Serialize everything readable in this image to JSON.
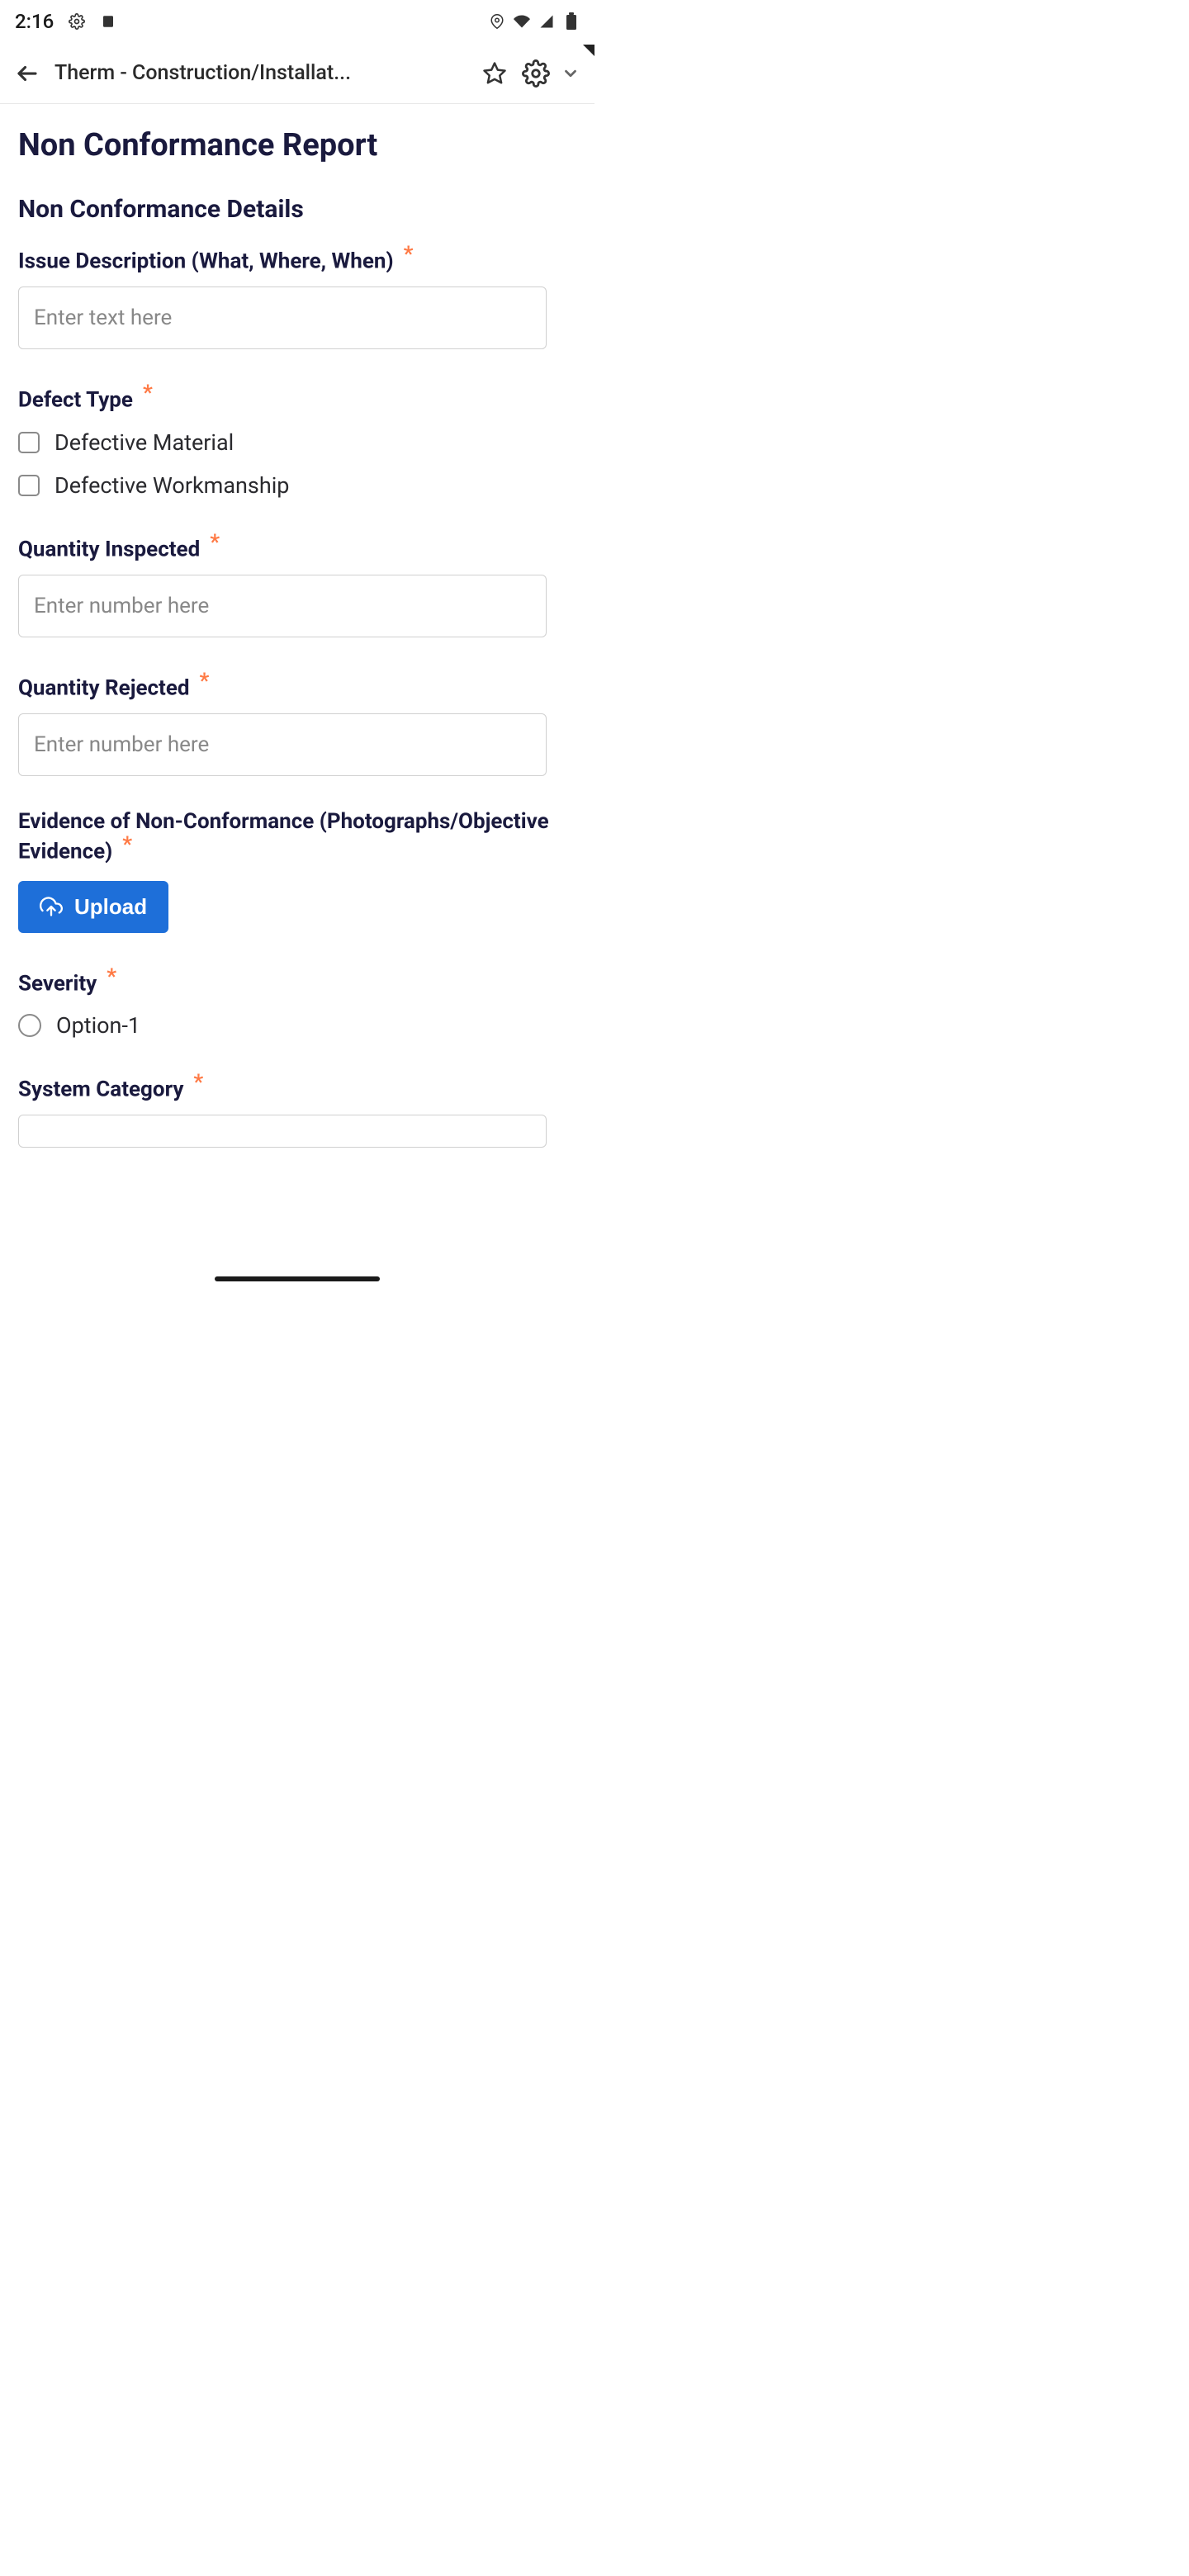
{
  "status_bar": {
    "time": "2:16",
    "icons_left": [
      "gear",
      "card"
    ],
    "icons_right": [
      "location",
      "wifi",
      "signal",
      "battery"
    ]
  },
  "top_bar": {
    "title": "Therm - Construction/Installat..."
  },
  "page": {
    "title": "Non Conformance Report",
    "section_title": "Non Conformance Details"
  },
  "fields": {
    "issue_description": {
      "label": "Issue Description (What, Where, When)",
      "required": true,
      "placeholder": "Enter text here"
    },
    "defect_type": {
      "label": "Defect Type",
      "required": true,
      "options": [
        {
          "label": "Defective Material",
          "checked": false
        },
        {
          "label": "Defective Workmanship",
          "checked": false
        }
      ]
    },
    "quantity_inspected": {
      "label": "Quantity Inspected",
      "required": true,
      "placeholder": "Enter number here"
    },
    "quantity_rejected": {
      "label": "Quantity Rejected",
      "required": true,
      "placeholder": "Enter number here"
    },
    "evidence": {
      "label": "Evidence of Non-Conformance (Photographs/Objective Evidence)",
      "required": true,
      "upload_label": "Upload"
    },
    "severity": {
      "label": "Severity",
      "required": true,
      "options": [
        {
          "label": "Option-1",
          "selected": false
        }
      ]
    },
    "system_category": {
      "label": "System Category",
      "required": true
    }
  }
}
